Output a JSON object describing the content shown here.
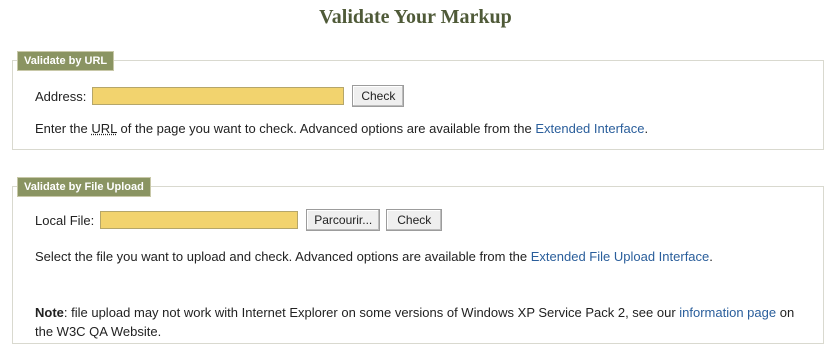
{
  "page": {
    "title": "Validate Your Markup"
  },
  "url_panel": {
    "legend": "Validate by URL",
    "address_label": "Address:",
    "address_value": "",
    "check_button": "Check",
    "help_pre": "Enter the ",
    "help_url": "URL",
    "help_mid": " of the page you want to check. Advanced options are available from the ",
    "help_link": "Extended Interface",
    "help_post": "."
  },
  "upload_panel": {
    "legend": "Validate by File Upload",
    "file_label": "Local File:",
    "file_value": "",
    "browse_button": "Parcourir...",
    "check_button": "Check",
    "help_pre": "Select the file you want to upload and check. Advanced options are available from the ",
    "help_link": "Extended File Upload Interface",
    "help_post": ".",
    "note_label": "Note",
    "note_text": ": file upload may not work with Internet Explorer on some versions of Windows XP Service Pack 2, see our ",
    "note_link": "information page",
    "note_post": " on the W3C QA Website."
  },
  "colors": {
    "legend_bg": "#8a9462",
    "field_bg": "#f2d36e",
    "link": "#2a5e9b",
    "title": "#4f5a38"
  }
}
